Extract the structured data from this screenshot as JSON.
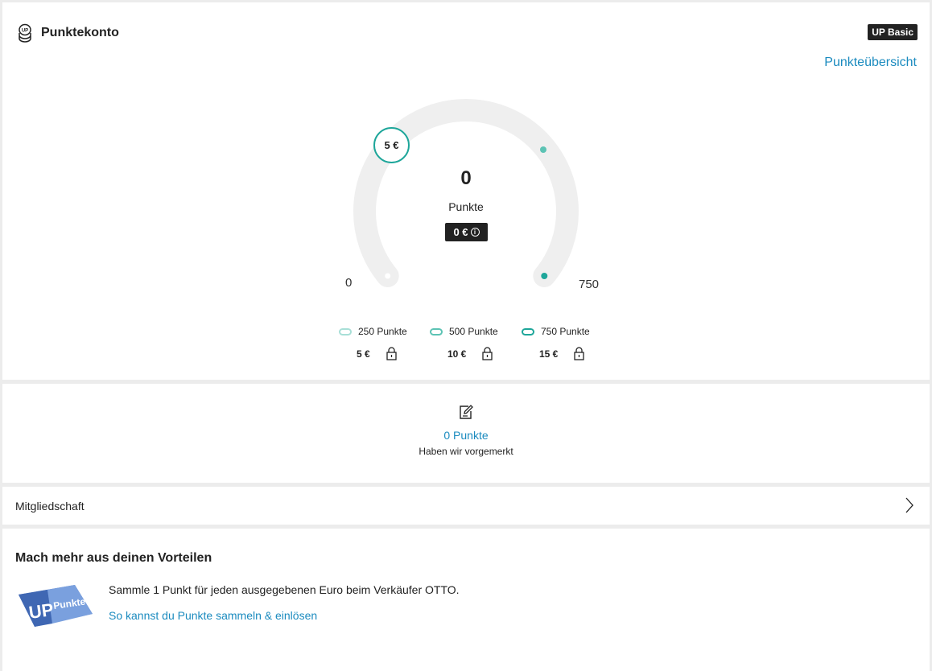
{
  "account": {
    "title": "Punktekonto",
    "badge": "UP Basic",
    "overview_link": "Punkteübersicht",
    "gauge": {
      "min_label": "0",
      "max_label": "750",
      "points": "0",
      "points_label": "Punkte",
      "euro_value": "0 €",
      "info_symbol": "i",
      "milestone_bubble": "5 €",
      "fill_fraction": 0
    },
    "tiers": [
      {
        "points": "250 Punkte",
        "reward": "5 €",
        "color": "#a8dfd7"
      },
      {
        "points": "500 Punkte",
        "reward": "10 €",
        "color": "#5cc3b4"
      },
      {
        "points": "750 Punkte",
        "reward": "15 €",
        "color": "#1ea69a"
      }
    ]
  },
  "pending": {
    "value": "0 Punkte",
    "subtitle": "Haben wir vorgemerkt"
  },
  "membership": {
    "label": "Mitgliedschaft"
  },
  "benefits": {
    "title": "Mach mehr aus deinen Vorteilen",
    "text": "Sammle 1 Punkt für jeden ausgegebenen Euro beim Verkäufer OTTO.",
    "link": "So kannst du Punkte sammeln & einlösen",
    "logo_text_up": "UP",
    "logo_text_punkte": "Punkte"
  },
  "colors": {
    "accent_link": "#1b8bbf",
    "teal": "#1ea69a",
    "gauge_track": "#efefef"
  }
}
